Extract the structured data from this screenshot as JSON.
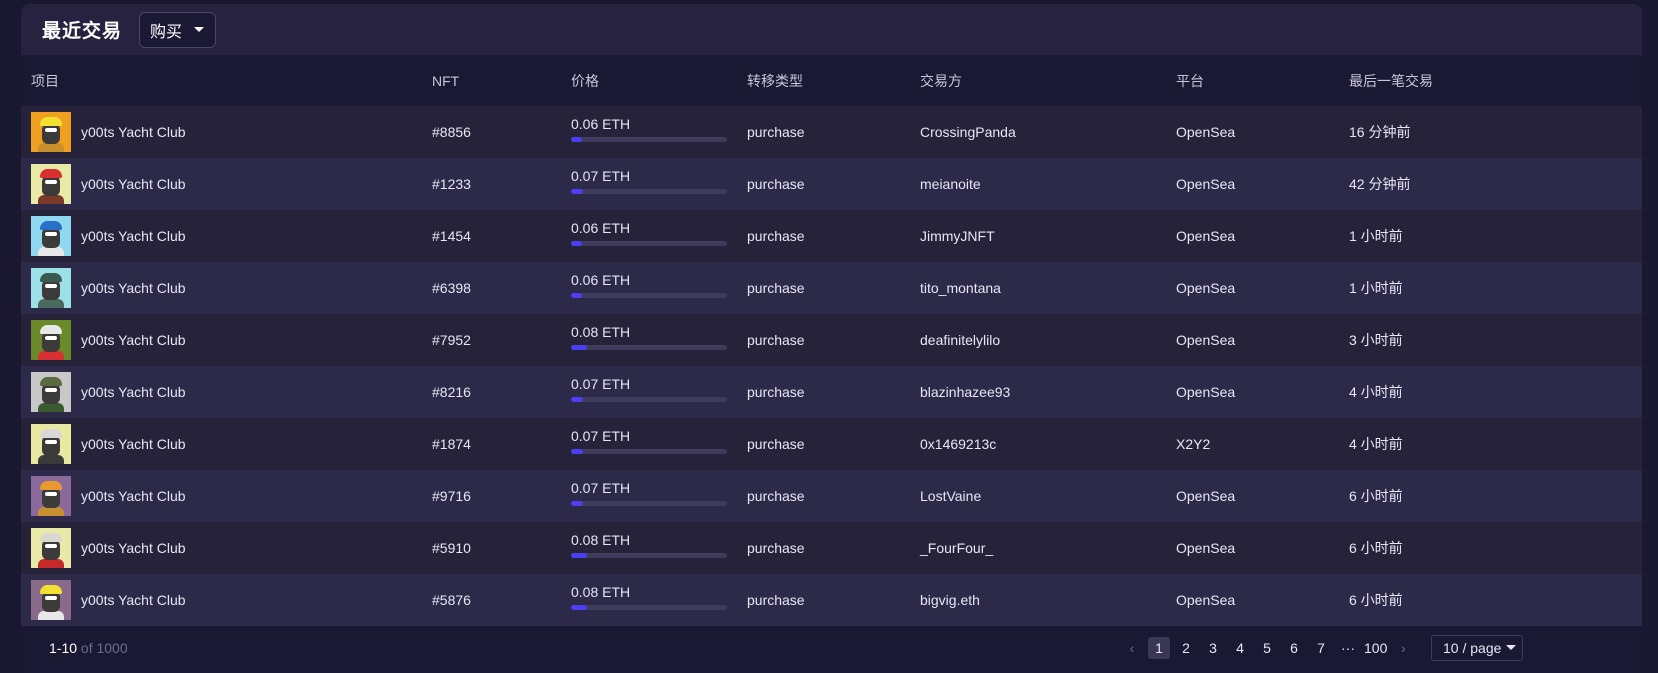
{
  "header": {
    "title": "最近交易",
    "filter_value": "购买"
  },
  "columns": [
    "项目",
    "NFT",
    "价格",
    "转移类型",
    "交易方",
    "平台",
    "最后一笔交易"
  ],
  "rows": [
    {
      "project": "y00ts Yacht Club",
      "nft": "#8856",
      "price": "0.06 ETH",
      "price_fill": 0.07,
      "type": "purchase",
      "party": "CrossingPanda",
      "platform": "OpenSea",
      "last": "16 分钟前",
      "avatar_bg": "#f0a020",
      "hat": "#f2e130",
      "body": "#c8902a"
    },
    {
      "project": "y00ts Yacht Club",
      "nft": "#1233",
      "price": "0.07 ETH",
      "price_fill": 0.08,
      "type": "purchase",
      "party": "meianoite",
      "platform": "OpenSea",
      "last": "42 分钟前",
      "avatar_bg": "#eaeaa8",
      "hat": "#d83030",
      "body": "#7a3a2a"
    },
    {
      "project": "y00ts Yacht Club",
      "nft": "#1454",
      "price": "0.06 ETH",
      "price_fill": 0.07,
      "type": "purchase",
      "party": "JimmyJNFT",
      "platform": "OpenSea",
      "last": "1 小时前",
      "avatar_bg": "#8fd8f0",
      "hat": "#2a70c8",
      "body": "#e8e8e8"
    },
    {
      "project": "y00ts Yacht Club",
      "nft": "#6398",
      "price": "0.06 ETH",
      "price_fill": 0.07,
      "type": "purchase",
      "party": "tito_montana",
      "platform": "OpenSea",
      "last": "1 小时前",
      "avatar_bg": "#9ee0e8",
      "hat": "#3a5a50",
      "body": "#4a6a60"
    },
    {
      "project": "y00ts Yacht Club",
      "nft": "#7952",
      "price": "0.08 ETH",
      "price_fill": 0.1,
      "type": "purchase",
      "party": "deafinitelylilo",
      "platform": "OpenSea",
      "last": "3 小时前",
      "avatar_bg": "#6a8a2a",
      "hat": "#e8e8e8",
      "body": "#d83030"
    },
    {
      "project": "y00ts Yacht Club",
      "nft": "#8216",
      "price": "0.07 ETH",
      "price_fill": 0.08,
      "type": "purchase",
      "party": "blazinhazee93",
      "platform": "OpenSea",
      "last": "4 小时前",
      "avatar_bg": "#c8c8c8",
      "hat": "#5a6a40",
      "body": "#3a5a30"
    },
    {
      "project": "y00ts Yacht Club",
      "nft": "#1874",
      "price": "0.07 ETH",
      "price_fill": 0.08,
      "type": "purchase",
      "party": "0x1469213c",
      "platform": "X2Y2",
      "last": "4 小时前",
      "avatar_bg": "#e8e8a0",
      "hat": "#d8d8d8",
      "body": "#3a3a3a"
    },
    {
      "project": "y00ts Yacht Club",
      "nft": "#9716",
      "price": "0.07 ETH",
      "price_fill": 0.08,
      "type": "purchase",
      "party": "LostVaine",
      "platform": "OpenSea",
      "last": "6 小时前",
      "avatar_bg": "#8a6a9a",
      "hat": "#e89a30",
      "body": "#c89030"
    },
    {
      "project": "y00ts Yacht Club",
      "nft": "#5910",
      "price": "0.08 ETH",
      "price_fill": 0.1,
      "type": "purchase",
      "party": "_FourFour_",
      "platform": "OpenSea",
      "last": "6 小时前",
      "avatar_bg": "#e8e8a8",
      "hat": "#d8d8d0",
      "body": "#c82828"
    },
    {
      "project": "y00ts Yacht Club",
      "nft": "#5876",
      "price": "0.08 ETH",
      "price_fill": 0.1,
      "type": "purchase",
      "party": "bigvig.eth",
      "platform": "OpenSea",
      "last": "6 小时前",
      "avatar_bg": "#8a6a8a",
      "hat": "#f2e130",
      "body": "#e8e8e8"
    }
  ],
  "footer": {
    "range": "1-10",
    "total": "of 1000",
    "pages": [
      "1",
      "2",
      "3",
      "4",
      "5",
      "6",
      "7",
      "···",
      "100"
    ],
    "page_size": "10 / page"
  },
  "icons": {
    "prev": "chevron-left-icon",
    "next": "chevron-right-icon",
    "dropdown": "caret-down-icon"
  },
  "colors": {
    "accent": "#4a3ff2",
    "background": "#1b1833"
  }
}
